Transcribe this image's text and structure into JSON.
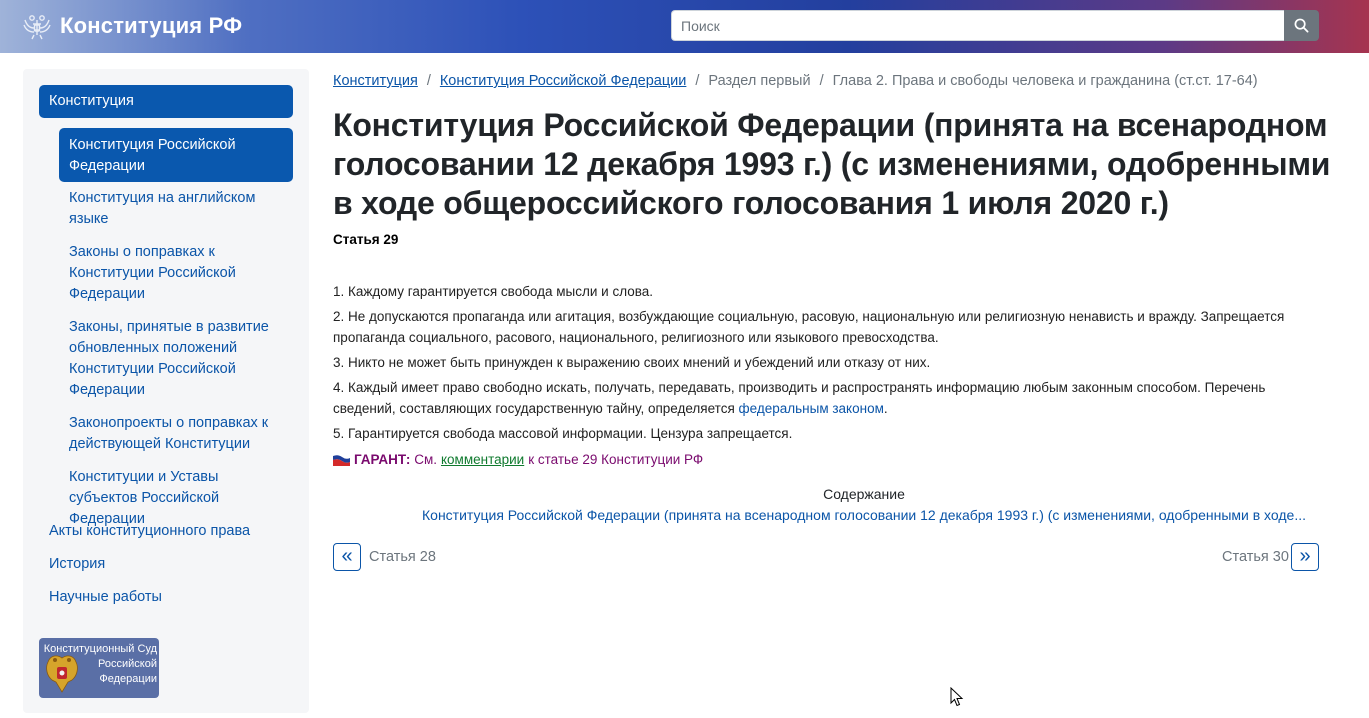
{
  "header": {
    "site_title": "Конституция РФ",
    "search_placeholder": "Поиск",
    "search_value": ""
  },
  "sidebar": {
    "top_item": "Конституция",
    "active_sub_item": "Конституция Российской Федерации",
    "sub_items": [
      "Конституция на английском языке",
      "Законы о поправках к Конституции Российской Федерации",
      "Законы, принятые в развитие обновленных положений Конституции Российской Федерации",
      "Законопроекты о поправках к действующей Конституции",
      "Конституции и Уставы субъектов Российской Федерации"
    ],
    "top_items": [
      "Акты конституционного права",
      "История",
      "Научные работы"
    ],
    "court_badge_text": "Конституционный Суд Российской Федерации"
  },
  "breadcrumb": {
    "items": [
      "Конституция",
      "Конституция Российской Федерации",
      "Раздел первый",
      "Глава 2. Права и свободы человека и гражданина (ст.ст. 17-64)"
    ],
    "separator": "/"
  },
  "document": {
    "title": "Конституция Российской Федерации (принята на всенародном голосовании 12 декабря 1993 г.) (с изменениями, одобренными в ходе общероссийского голосования 1 июля 2020 г.)",
    "article_number": "Статья 29",
    "paragraphs": {
      "p1": "1. Каждому гарантируется свобода мысли и слова.",
      "p2": "2. Не допускаются пропаганда или агитация, возбуждающие социальную, расовую, национальную или религиозную ненависть и вражду. Запрещается пропаганда социального, расового, национального, религиозного или языкового превосходства.",
      "p3": "3. Никто не может быть принужден к выражению своих мнений и убеждений или отказу от них.",
      "p4_text": "4. Каждый имеет право свободно искать, получать, передавать, производить и распространять информацию любым законным способом. Перечень сведений, составляющих государственную тайну, определяется",
      "p4_link": "федеральным законом",
      "p4_end": ".",
      "p5": "5. Гарантируется свобода массовой информации. Цензура запрещается."
    },
    "garant": {
      "label": "ГАРАНТ:",
      "prefix": "См.",
      "link": "комментарии",
      "suffix": "к статье 29 Конституции РФ"
    },
    "toc": {
      "label": "Содержание",
      "link": "Конституция Российской Федерации (принята на всенародном голосовании 12 декабря 1993 г.) (с изменениями, одобренными в ходе..."
    },
    "pager": {
      "prev_symbol": "«",
      "prev_label": "Статья 28",
      "next_symbol": "»",
      "next_label": "Статья 30"
    }
  },
  "colors": {
    "primary": "#0a58ae",
    "link": "#0b55a8",
    "garant": "#7a0a6e",
    "garant_link": "#0f7a2e",
    "sidebar_bg": "#f5f6f8"
  },
  "icons": {
    "brand": "double-headed-eagle-icon",
    "search": "search-icon",
    "court": "coat-of-arms-icon",
    "garant": "garant-flag-icon"
  }
}
